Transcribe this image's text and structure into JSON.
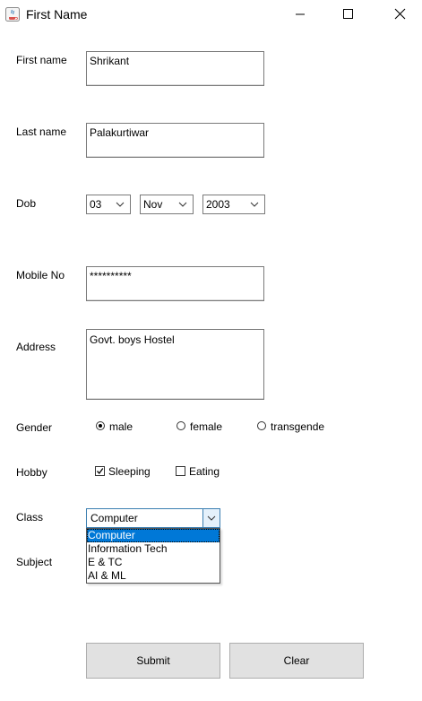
{
  "window": {
    "title": "First Name"
  },
  "form": {
    "first_name": {
      "label": "First name",
      "value": "Shrikant"
    },
    "last_name": {
      "label": "Last name",
      "value": "Palakurtiwar"
    },
    "dob": {
      "label": "Dob",
      "day": "03",
      "month": "Nov",
      "year": "2003"
    },
    "mobile": {
      "label": "Mobile No",
      "value": "**********"
    },
    "address": {
      "label": "Address",
      "value": "Govt. boys Hostel"
    },
    "gender": {
      "label": "Gender",
      "options": [
        "male",
        "female",
        "transgende"
      ],
      "selected": "male"
    },
    "hobby": {
      "label": "Hobby",
      "options": [
        {
          "label": "Sleeping",
          "checked": true
        },
        {
          "label": "Eating",
          "checked": false
        }
      ]
    },
    "class": {
      "label": "Class",
      "value": "Computer",
      "options": [
        "Computer",
        "Information Tech",
        "E & TC",
        "AI & ML"
      ]
    },
    "subject": {
      "label": "Subject"
    }
  },
  "buttons": {
    "submit": "Submit",
    "clear": "Clear"
  },
  "colors": {
    "selection": "#0078d7",
    "focus_border": "#3c7fb1",
    "button_bg": "#e1e1e1"
  },
  "icons": [
    "java-icon",
    "minimize-icon",
    "maximize-icon",
    "close-icon",
    "chevron-down-icon"
  ]
}
